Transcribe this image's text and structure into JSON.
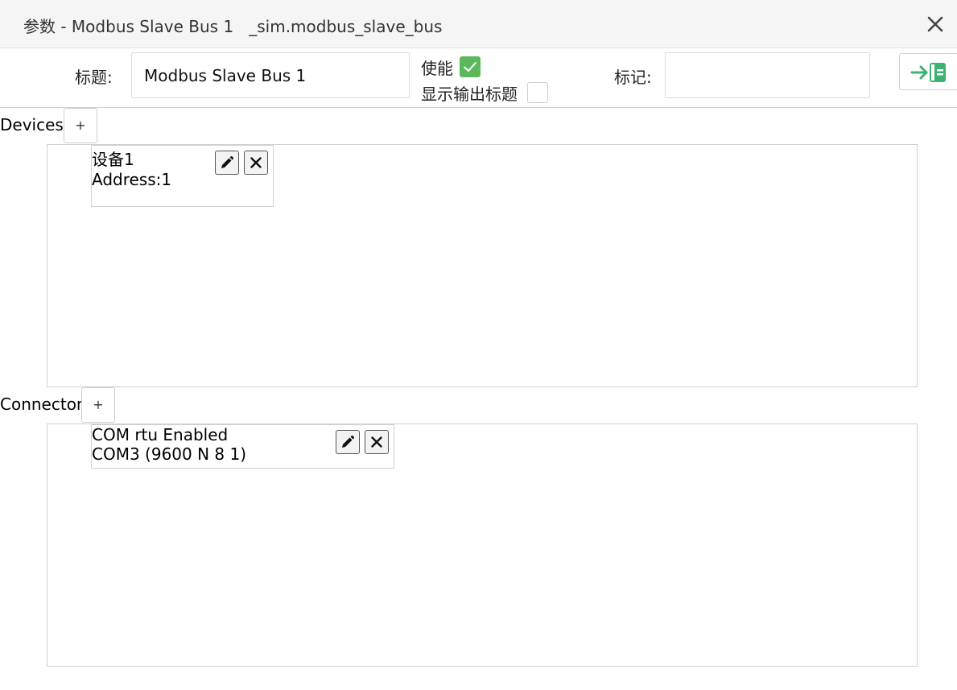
{
  "window": {
    "title": "参数 - Modbus Slave Bus 1   _sim.modbus_slave_bus",
    "close_icon": "close-icon"
  },
  "form": {
    "title_label": "标题:",
    "title_value": "Modbus Slave Bus 1",
    "enable_label": "使能",
    "enable_checked": true,
    "show_output_title_label": "显示输出标题",
    "show_output_title_checked": false,
    "tag_label": "标记:",
    "tag_value": "",
    "export_icon": "export-icon"
  },
  "devices": {
    "label": "Devices",
    "add_label": "+",
    "items": [
      {
        "name": "设备1",
        "detail": "Address:1"
      }
    ]
  },
  "connector": {
    "label": "Connector",
    "add_label": "+",
    "items": [
      {
        "name": "COM rtu Enabled",
        "detail": "COM3 (9600 N 8 1)"
      }
    ]
  },
  "colors": {
    "checkbox_on": "#5cb85c",
    "export_accent": "#3cb371"
  }
}
